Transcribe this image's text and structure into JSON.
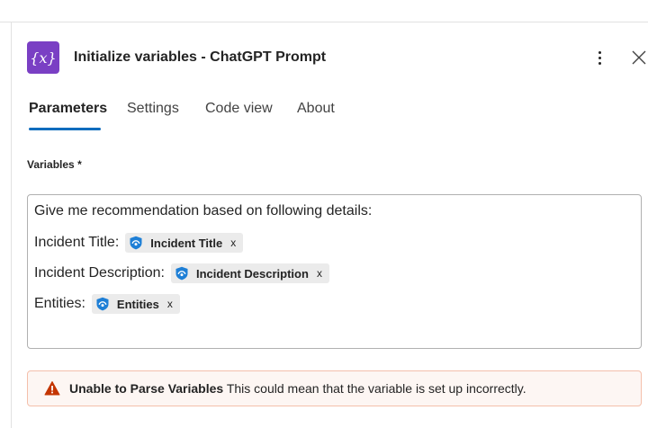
{
  "header": {
    "title": "Initialize variables - ChatGPT Prompt",
    "icon_glyph": "{x}",
    "icon_name": "variable-icon",
    "icon_color": "#7a3fc4"
  },
  "tabs": [
    {
      "label": "Parameters",
      "active": true
    },
    {
      "label": "Settings",
      "active": false
    },
    {
      "label": "Code view",
      "active": false
    },
    {
      "label": "About",
      "active": false
    }
  ],
  "accent_color": "#0f6cbd",
  "variables": {
    "label": "Variables",
    "required_mark": "*",
    "lines": [
      {
        "text": "Give me recommendation based on following details:",
        "token": null
      },
      {
        "text": "Incident Title:",
        "token": "Incident Title"
      },
      {
        "text": "Incident Description:",
        "token": "Incident Description"
      },
      {
        "text": "Entities:",
        "token": "Entities"
      }
    ],
    "token_remove_glyph": "x",
    "token_icon_name": "sentinel-icon"
  },
  "warning": {
    "title": "Unable to Parse Variables",
    "message": "This could mean that the variable is set up incorrectly.",
    "icon_name": "warning-icon",
    "color": "#c43501"
  }
}
